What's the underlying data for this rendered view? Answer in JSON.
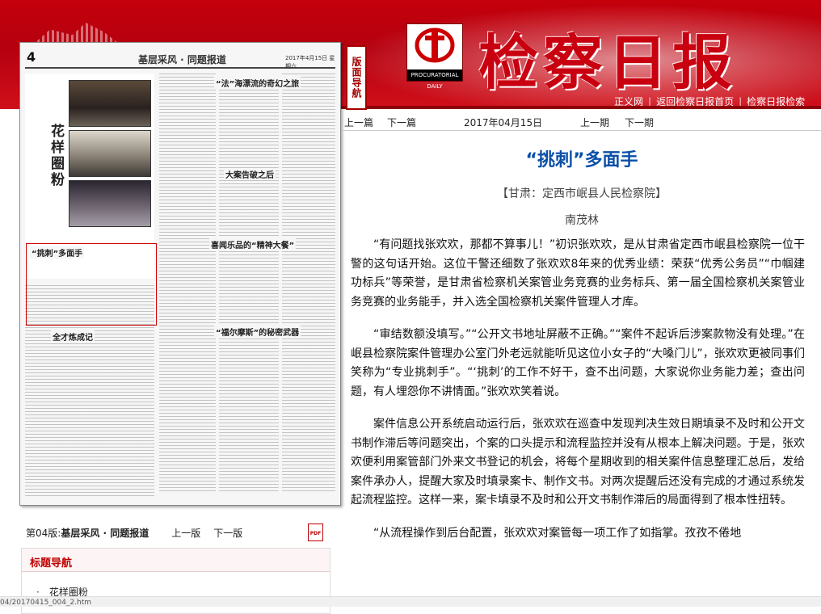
{
  "header": {
    "masthead": "检察日报",
    "logo_caption": "检察日报",
    "logo_english": "PROCURATORIAL DAILY",
    "links": [
      "正义网",
      "返回检察日报首页",
      "检察日报检索"
    ],
    "vertical_label": "版面导航"
  },
  "colors": {
    "brand_red": "#c80010",
    "title_blue": "#0a4fa8",
    "nav_red": "#c00000"
  },
  "paper_thumb": {
    "page_number": "4",
    "section_title": "基层采风 · 同题报道",
    "date_line": "2017年4月15日 星期六",
    "feature_title": "花样圈粉",
    "headlines": [
      {
        "text": "“法”海漂流的奇幻之旅"
      },
      {
        "text": "大案告破之后"
      },
      {
        "text": "喜闻乐品的“精神大餐”"
      },
      {
        "text": "“福尔摩斯”的秘密武器"
      },
      {
        "text": "“挑刺”多面手"
      },
      {
        "text": "全才炼成记"
      }
    ]
  },
  "page_bar": {
    "page_label": "第04版:",
    "page_name": "基层采风 · 同题报道",
    "prev_page": "上一版",
    "next_page": "下一版",
    "pdf_icon": "PDF"
  },
  "title_nav": {
    "heading": "标题导航",
    "items": [
      "花样圈粉"
    ]
  },
  "date_bar": {
    "prev_article": "上一篇",
    "next_article": "下一篇",
    "date": "2017年04月15日",
    "prev_issue": "上一期",
    "next_issue": "下一期"
  },
  "article": {
    "title": "“挑刺”多面手",
    "source": "【甘肃：定西市岷县人民检察院】",
    "author": "南茂林",
    "paragraphs": [
      "“有问题找张欢欢，那都不算事儿！”初识张欢欢，是从甘肃省定西市岷县检察院一位干警的这句话开始。这位干警还细数了张欢欢8年来的优秀业绩：荣获“优秀公务员”“巾帼建功标兵”等荣誉，是甘肃省检察机关案管业务竞赛的业务标兵、第一届全国检察机关案管业务竞赛的业务能手，并入选全国检察机关案件管理人才库。",
      "“审结数额没填写。”“公开文书地址屏蔽不正确。”“案件不起诉后涉案款物没有处理。”在岷县检察院案件管理办公室门外老远就能听见这位小女子的“大嗓门儿”，张欢欢更被同事们笑称为“专业挑刺手”。“‘挑刺’的工作不好干，查不出问题，大家说你业务能力差；查出问题，有人埋怨你不讲情面。”张欢欢笑着说。",
      "案件信息公开系统启动运行后，张欢欢在巡查中发现判决生效日期填录不及时和公开文书制作滞后等问题突出，个案的口头提示和流程监控并没有从根本上解决问题。于是，张欢欢便利用案管部门外来文书登记的机会，将每个星期收到的相关案件信息整理汇总后，发给案件承办人，提醒大家及时填录案卡、制作文书。对两次提醒后还没有完成的才通过系统发起流程监控。这样一来，案卡填录不及时和公开文书制作滞后的局面得到了根本性扭转。",
      "“从流程操作到后台配置，张欢欢对案管每一项工作了如指掌。孜孜不倦地"
    ]
  },
  "status_url": "04/20170415_004_2.htm"
}
